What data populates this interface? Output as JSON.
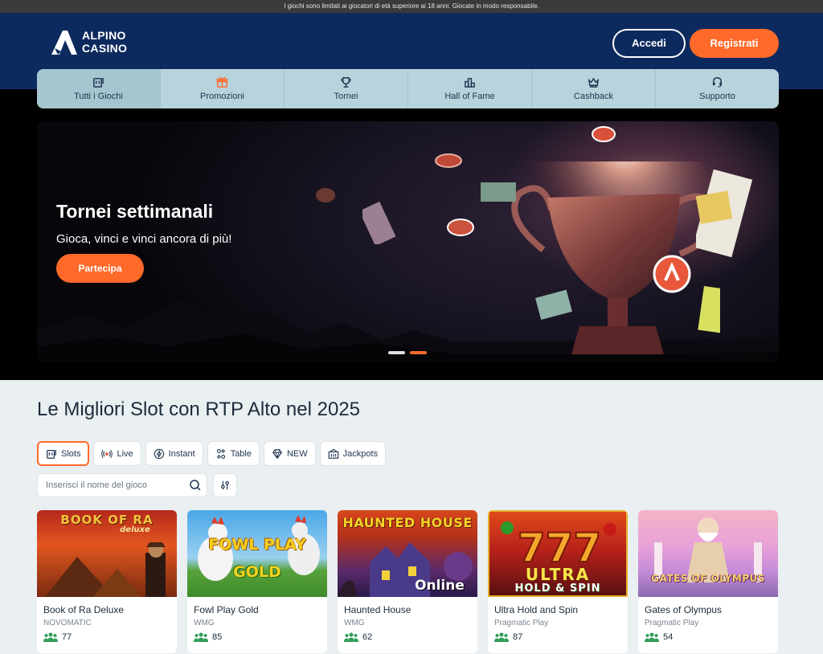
{
  "topbar": {
    "notice": "I giochi sono limitati ai giocatori di età superiore ai 18 anni. Giocate in modo responsabile."
  },
  "header": {
    "logo_line1": "ALPINO",
    "logo_line2": "CASINO",
    "login_label": "Accedi",
    "register_label": "Registrati"
  },
  "nav": {
    "items": [
      {
        "label": "Tutti i Giochi",
        "icon": "slot-machine-icon"
      },
      {
        "label": "Promozioni",
        "icon": "gift-icon"
      },
      {
        "label": "Tornei",
        "icon": "trophy-icon"
      },
      {
        "label": "Hall of Fame",
        "icon": "podium-icon"
      },
      {
        "label": "Cashback",
        "icon": "crown-icon"
      },
      {
        "label": "Supporto",
        "icon": "headset-icon"
      }
    ]
  },
  "hero": {
    "title": "Tornei settimanali",
    "subtitle": "Gioca, vinci e vinci ancora di più!",
    "cta": "Partecipa",
    "slide_count": 2,
    "active_slide": 2
  },
  "section": {
    "title": "Le Migliori Slot con RTP Alto nel 2025"
  },
  "filters": [
    {
      "label": "Slots",
      "icon": "slot-machine-icon",
      "active": true
    },
    {
      "label": "Live",
      "icon": "live-broadcast-icon"
    },
    {
      "label": "Instant",
      "icon": "lightning-icon"
    },
    {
      "label": "Table",
      "icon": "table-games-icon"
    },
    {
      "label": "NEW",
      "icon": "diamond-icon"
    },
    {
      "label": "Jackpots",
      "icon": "jackpot-icon"
    }
  ],
  "search": {
    "placeholder": "Inserisci il nome del gioco"
  },
  "games": [
    {
      "name": "Book of Ra Deluxe",
      "provider": "NOVOMATIC",
      "players": "77",
      "art_title": "BOOK OF RA",
      "art_sub": "deluxe"
    },
    {
      "name": "Fowl Play Gold",
      "provider": "WMG",
      "players": "85",
      "art_title": "FOWL PLAY",
      "art_sub": "GOLD"
    },
    {
      "name": "Haunted House",
      "provider": "WMG",
      "players": "62",
      "art_title": "HAUNTED HOUSE",
      "art_sub": "Online"
    },
    {
      "name": "Ultra Hold and Spin",
      "provider": "Pragmatic Play",
      "players": "87",
      "art_title": "ULTRA",
      "art_sub": "HOLD & SPIN"
    },
    {
      "name": "Gates of Olympus",
      "provider": "Pragmatic Play",
      "players": "54",
      "art_title": "GATES OF OLYMPUS",
      "art_sub": ""
    }
  ],
  "colors": {
    "brand_navy": "#0d2a5e",
    "accent_orange": "#ff6a2b",
    "nav_bg": "#b7d3db",
    "player_icon_green": "#2f9d57"
  }
}
